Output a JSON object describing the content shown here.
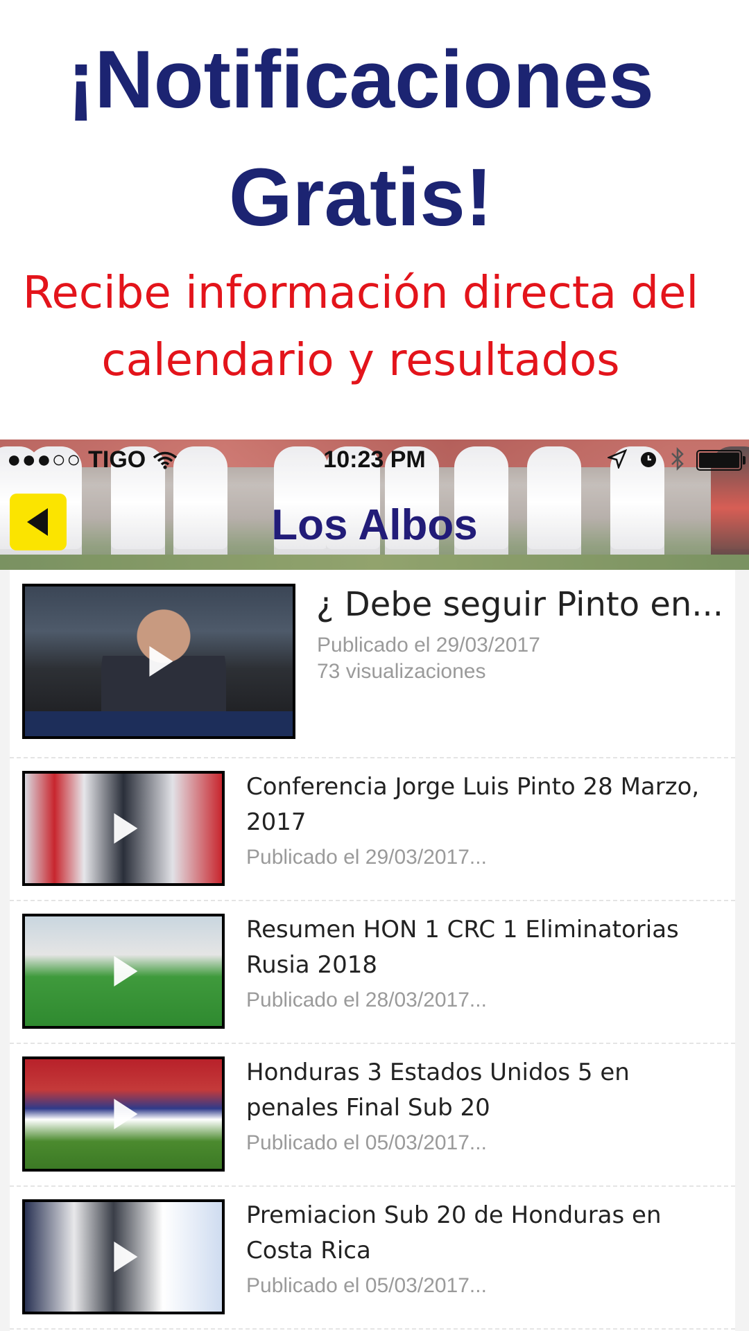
{
  "promo": {
    "title_line1": "¡Notificaciones",
    "title_line2": "Gratis!",
    "subtitle_line1": "Recibe información directa del",
    "subtitle_line2": "calendario y resultados"
  },
  "status_bar": {
    "signal": "●●●○○",
    "carrier": "TIGO",
    "time": "10:23 PM"
  },
  "nav": {
    "title": "Los Albos"
  },
  "videos": [
    {
      "title": "¿ Debe seguir Pinto en...",
      "published": "Publicado el 29/03/2017",
      "views": "73 visualizaciones"
    },
    {
      "title": "Conferencia Jorge Luis Pinto 28 Marzo, 2017",
      "published": "Publicado el 29/03/2017..."
    },
    {
      "title": "Resumen HON 1  CRC 1 Eliminatorias Rusia 2018",
      "published": "Publicado el 28/03/2017..."
    },
    {
      "title": "Honduras 3 Estados Unidos 5 en penales Final Sub 20",
      "published": "Publicado el 05/03/2017..."
    },
    {
      "title": "Premiacion Sub 20 de Honduras en Costa Rica",
      "published": "Publicado el 05/03/2017..."
    }
  ],
  "colors": {
    "promo_title": "#1c2472",
    "promo_subtitle": "#e3141b",
    "back_button": "#fbe400",
    "nav_title": "#221c78"
  }
}
